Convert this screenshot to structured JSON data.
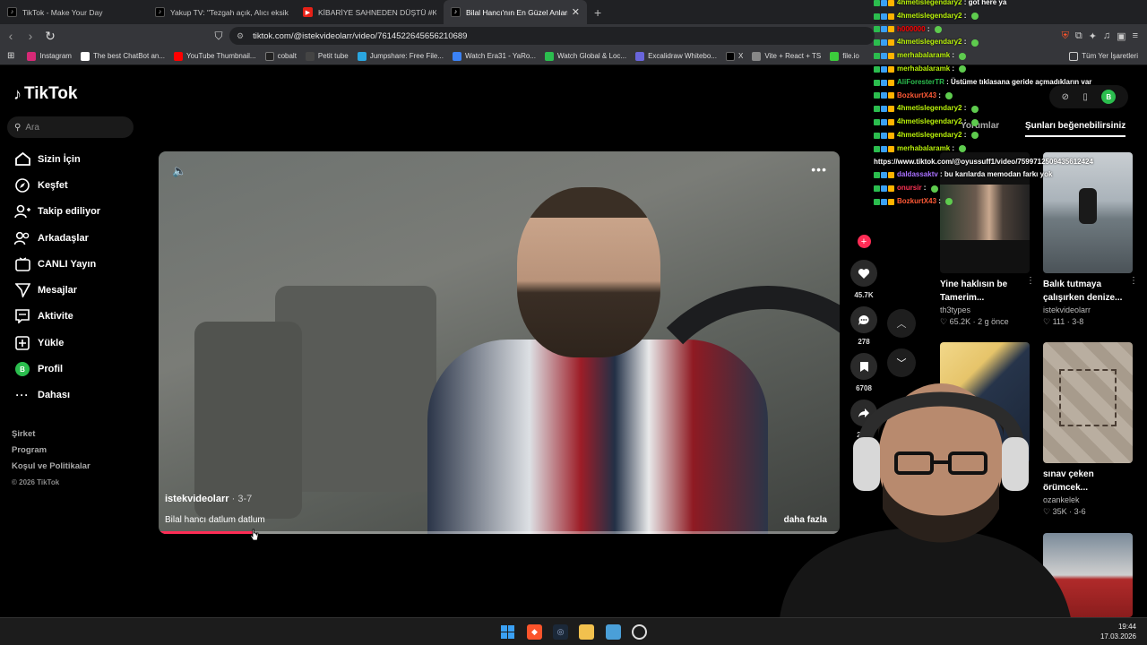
{
  "browser": {
    "tabs": [
      {
        "title": "TikTok - Make Your Day",
        "favicon_color": "#000000",
        "active": false
      },
      {
        "title": "Yakup TV: \"Tezgah açık, Alıcı eksik!\"",
        "favicon_color": "#000000",
        "active": false
      },
      {
        "title": "KİBARİYE SAHNEDEN DÜŞTÜ #KİBAR",
        "favicon_color": "#ff0000",
        "active": false
      },
      {
        "title": "Bilal Hancı'nın En Güzel Anları ve",
        "favicon_color": "#000000",
        "active": true
      }
    ],
    "url": "tiktok.com/@istekvideolarr/video/7614522645656210689",
    "bookmarks": [
      {
        "label": "Instagram",
        "color": "#d62976"
      },
      {
        "label": "The best ChatBot an...",
        "color": "#ffffff"
      },
      {
        "label": "YouTube Thumbnail...",
        "color": "#ff0000"
      },
      {
        "label": "cobalt",
        "color": "#222222"
      },
      {
        "label": "Petit tube",
        "color": "#444444"
      },
      {
        "label": "Jumpshare: Free File...",
        "color": "#2aa6e0"
      },
      {
        "label": "Watch Era31 - YaRo...",
        "color": "#3b82f6"
      },
      {
        "label": "Watch Global & Loc...",
        "color": "#2bbd4e"
      },
      {
        "label": "Excalidraw Whitebo...",
        "color": "#6965db"
      },
      {
        "label": "X",
        "color": "#000000"
      },
      {
        "label": "Vite + React + TS",
        "color": "#888888"
      },
      {
        "label": "file.io",
        "color": "#3ccb3c"
      }
    ],
    "all_bookmarks": "Tüm Yer İşaretleri"
  },
  "tiktok": {
    "logo": "TikTok",
    "search_placeholder": "Ara",
    "sidebar": [
      {
        "label": "Sizin İçin",
        "icon": "home-icon"
      },
      {
        "label": "Keşfet",
        "icon": "compass-icon"
      },
      {
        "label": "Takip ediliyor",
        "icon": "following-icon"
      },
      {
        "label": "Arkadaşlar",
        "icon": "friends-icon"
      },
      {
        "label": "CANLI Yayın",
        "icon": "live-icon"
      },
      {
        "label": "Mesajlar",
        "icon": "messages-icon"
      },
      {
        "label": "Aktivite",
        "icon": "activity-icon"
      },
      {
        "label": "Yükle",
        "icon": "upload-icon"
      },
      {
        "label": "Profil",
        "icon": "profile-icon"
      },
      {
        "label": "Dahası",
        "icon": "more-icon"
      }
    ],
    "profile_initial": "B",
    "footer": {
      "company": "Şirket",
      "program": "Program",
      "terms": "Koşul ve Politikalar",
      "copyright": "© 2026 TikTok"
    },
    "video": {
      "author": "istekvideolarr",
      "date": "· 3-7",
      "caption": "Bilal hancı datlum datlum",
      "more": "daha fazla",
      "progress": 0.14
    },
    "actions": {
      "likes": "45.7K",
      "comments": "278",
      "saves": "6708",
      "shares": "22.1"
    },
    "right_tabs": {
      "comments": "Yorumlar",
      "suggested": "Şunları beğenebilirsiniz"
    },
    "cards": [
      {
        "title": "Yine haklısın be Tamerim...",
        "user": "th3types",
        "likes": "65.2K",
        "age": "2 g önce"
      },
      {
        "title": "Balık tutmaya çalışırken denize...",
        "user": "istekvideolarr",
        "likes": "111",
        "age": "3-8"
      },
      {
        "title": "",
        "user": "",
        "likes": "",
        "age": ""
      },
      {
        "title": "sınav çeken örümcek...",
        "user": "ozankelek",
        "likes": "35K",
        "age": "3-6"
      }
    ]
  },
  "chat": [
    {
      "user": "4hmetislegendary2",
      "msg": "got here ya",
      "color": "#b9f20a"
    },
    {
      "user": "4hmetislegendary2",
      "msg": "",
      "color": "#b9f20a"
    },
    {
      "user": "h000000",
      "msg": "",
      "color": "#ff0000"
    },
    {
      "user": "4hmetislegendary2",
      "msg": "",
      "color": "#b9f20a"
    },
    {
      "user": "merhabalaramk",
      "msg": "",
      "color": "#b9f20a"
    },
    {
      "user": "merhabalaramk",
      "msg": "",
      "color": "#b9f20a"
    },
    {
      "user": "AliForesterTR",
      "msg": "Üstüme tıklasana geride açmadıkların var",
      "color": "#2bbd4e"
    },
    {
      "user": "BozkurtX43",
      "msg": "",
      "color": "#ff5a36"
    },
    {
      "user": "4hmetislegendary2",
      "msg": "",
      "color": "#b9f20a"
    },
    {
      "user": "4hmetislegendary2",
      "msg": "",
      "color": "#b9f20a"
    },
    {
      "user": "4hmetislegendary2",
      "msg": "",
      "color": "#b9f20a"
    },
    {
      "user": "merhabalaramk",
      "msg": "",
      "color": "#b9f20a"
    },
    {
      "user": "",
      "msg": "https://www.tiktok.com/@oyussuff1/video/7599712509435612424",
      "color": "#ffffff"
    },
    {
      "user": "daldassaktv",
      "msg": "bu karılarda memodan farkı yok",
      "color": "#a970ff"
    },
    {
      "user": "onursir",
      "msg": "",
      "color": "#ff3355"
    },
    {
      "user": "BozkurtX43",
      "msg": "",
      "color": "#ff5a36"
    }
  ],
  "taskbar": {
    "time": "19:44",
    "date": "17.03.2026"
  }
}
